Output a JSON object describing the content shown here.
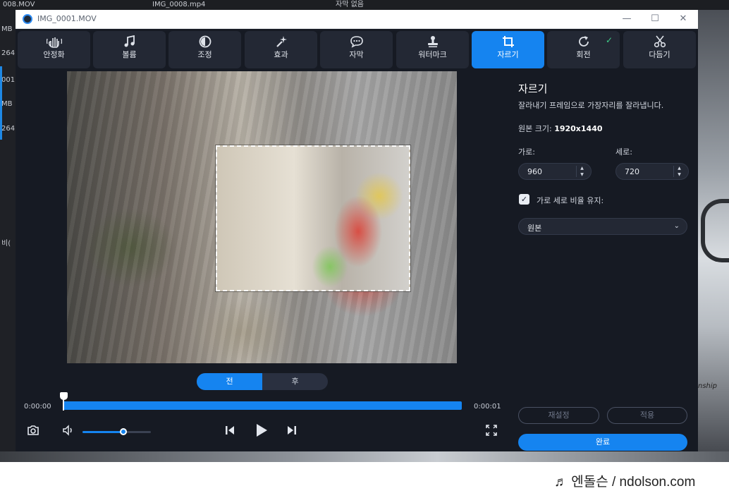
{
  "background_app": {
    "top_items": [
      "008.MOV",
      "IMG_0008.mp4",
      "자막 없음"
    ],
    "left_items": [
      "MB",
      "264",
      "001",
      "MB",
      "264",
      "비("
    ],
    "right_text": "nship"
  },
  "window": {
    "title": "IMG_0001.MOV",
    "controls": {
      "minimize": "—",
      "maximize": "☐",
      "close": "✕"
    }
  },
  "toolbar": {
    "tools": [
      {
        "label": "안정화",
        "icon": "hand-stabilize-icon",
        "active": false
      },
      {
        "label": "볼륨",
        "icon": "music-note-icon",
        "active": false
      },
      {
        "label": "조정",
        "icon": "contrast-icon",
        "active": false
      },
      {
        "label": "효과",
        "icon": "magic-wand-icon",
        "active": false
      },
      {
        "label": "자막",
        "icon": "speech-bubble-icon",
        "active": false
      },
      {
        "label": "워터마크",
        "icon": "stamp-icon",
        "active": false
      },
      {
        "label": "자르기",
        "icon": "crop-icon",
        "active": true
      },
      {
        "label": "회전",
        "icon": "rotate-icon",
        "active": false,
        "checked": true
      },
      {
        "label": "다듬기",
        "icon": "scissors-icon",
        "active": false
      }
    ]
  },
  "compare": {
    "before": "전",
    "after": "후",
    "selected": "before"
  },
  "timeline": {
    "start": "0:00:00",
    "end": "0:00:01",
    "progress": 0.0
  },
  "volume": {
    "level": 0.6
  },
  "crop_panel": {
    "title": "자르기",
    "description": "잘라내기 프레임으로 가장자리를 잘라냅니다.",
    "original_size_label": "원본 크기:",
    "original_size_value": "1920x1440",
    "width_label": "가로:",
    "width_value": "960",
    "height_label": "세로:",
    "height_value": "720",
    "keep_ratio_label": "가로 세로 비율 유지:",
    "keep_ratio_checked": true,
    "ratio_select": "원본",
    "reset_label": "재설정",
    "apply_label": "적용",
    "done_label": "완료"
  },
  "footer": {
    "watermark": "♬ 엔돌슨 / ndolson.com"
  },
  "colors": {
    "accent": "#1584f0",
    "window_bg": "#161a23",
    "tool_bg": "#232834",
    "check": "#3fd08a"
  }
}
